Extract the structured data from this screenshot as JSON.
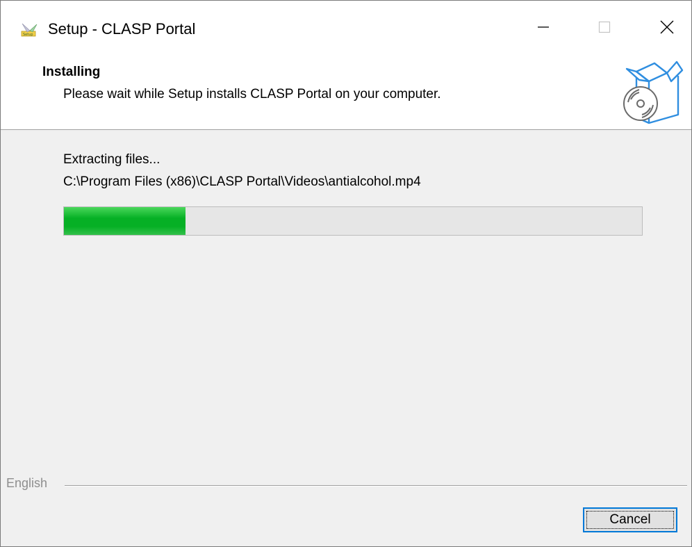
{
  "window": {
    "title": "Setup - CLASP Portal",
    "app_icon": "setup-icon",
    "controls": {
      "minimize_icon": "minimize-icon",
      "maximize_icon": "maximize-icon",
      "close_icon": "close-icon"
    }
  },
  "header": {
    "title": "Installing",
    "description": "Please wait while Setup installs CLASP Portal on your computer.",
    "image_icon": "box-disc-icon"
  },
  "status": {
    "label": "Extracting files...",
    "current_file": "C:\\Program Files (x86)\\CLASP Portal\\Videos\\antialcohol.mp4"
  },
  "progress": {
    "value": 0.21,
    "color": "#06b025"
  },
  "footer": {
    "language": "English",
    "cancel_label": "Cancel",
    "focus_color": "#0078d7"
  }
}
